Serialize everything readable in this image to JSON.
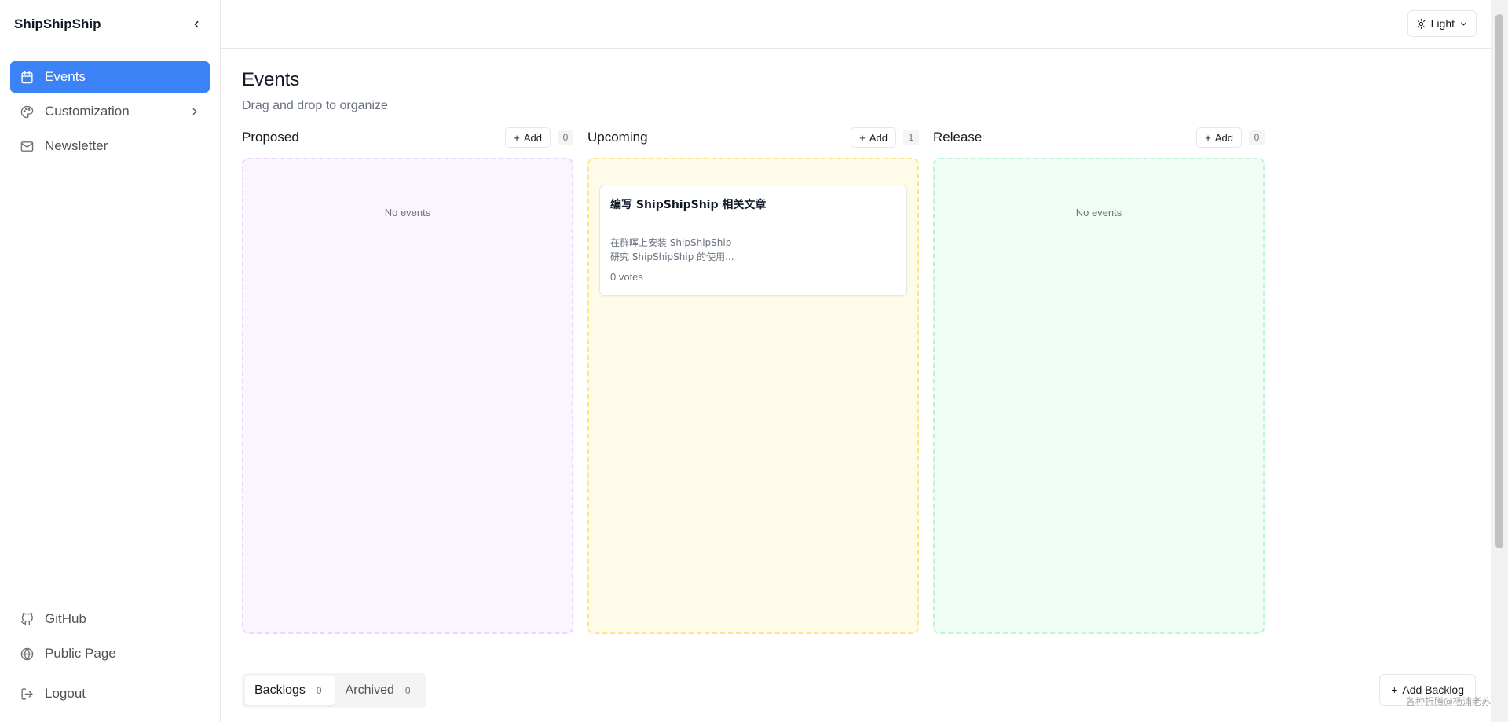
{
  "app": {
    "brand": "ShipShipShip"
  },
  "sidebar": {
    "items": [
      {
        "label": "Events",
        "icon": "calendar-icon",
        "active": true
      },
      {
        "label": "Customization",
        "icon": "palette-icon"
      },
      {
        "label": "Newsletter",
        "icon": "mail-icon"
      }
    ],
    "bottom_items": [
      {
        "label": "GitHub",
        "icon": "github-icon"
      },
      {
        "label": "Public Page",
        "icon": "globe-icon"
      }
    ],
    "logout_label": "Logout"
  },
  "topbar": {
    "theme_label": "Light"
  },
  "page": {
    "title": "Events",
    "subtitle": "Drag and drop to organize"
  },
  "columns": [
    {
      "title": "Proposed",
      "add_label": "Add",
      "count": "0",
      "empty_text": "No events"
    },
    {
      "title": "Upcoming",
      "add_label": "Add",
      "count": "1",
      "card": {
        "title": "编写 ShipShipShip 相关文章",
        "desc_line1": "在群晖上安装 ShipShipShip",
        "desc_line2": "研究 ShipShipShip 的使用...",
        "votes": "0 votes"
      }
    },
    {
      "title": "Release",
      "add_label": "Add",
      "count": "0",
      "empty_text": "No events"
    }
  ],
  "tabs": [
    {
      "label": "Backlogs",
      "count": "0",
      "active": true
    },
    {
      "label": "Archived",
      "count": "0"
    }
  ],
  "add_backlog_label": "Add Backlog",
  "watermark": "各种折腾@杨浦老苏",
  "colors": {
    "accent": "#3b82f6",
    "proposed_bg": "#faf5ff",
    "upcoming_bg": "#fefce8",
    "release_bg": "#f0fdf4"
  }
}
